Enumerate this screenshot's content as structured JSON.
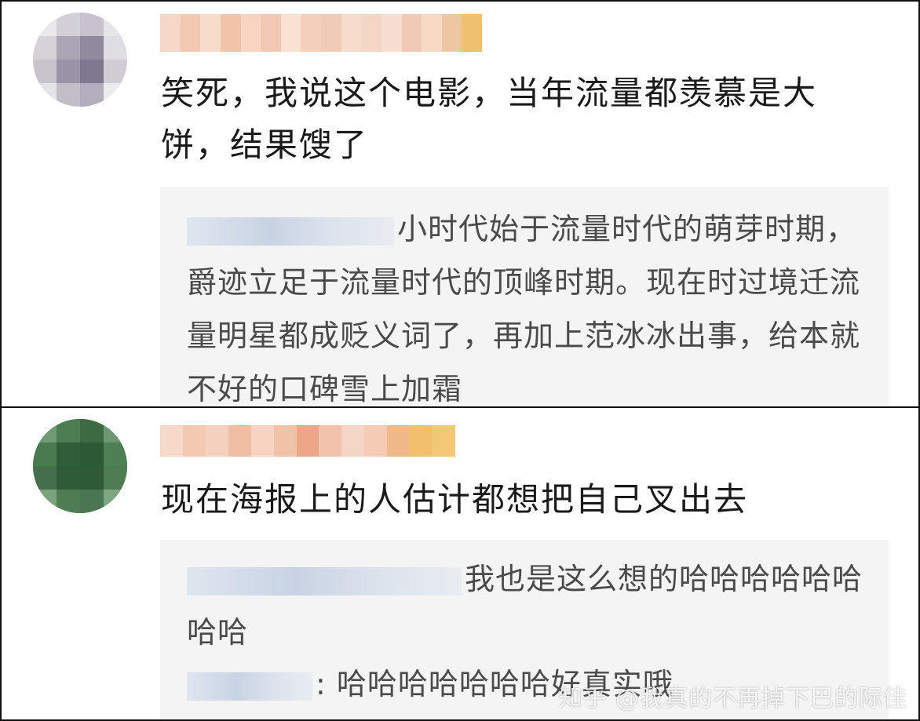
{
  "comments": [
    {
      "text": "笑死，我说这个电影，当年流量都羡慕是大饼，结果馊了",
      "replies": [
        {
          "text": "小时代始于流量时代的萌芽时期，爵迹立足于流量时代的顶峰时期。现在时过境迁流量明星都成贬义词了，再加上范冰冰出事，给本就不好的口碑雪上加霜"
        }
      ]
    },
    {
      "text": "现在海报上的人估计都想把自己叉出去",
      "replies": [
        {
          "text": "我也是这么想的哈哈哈哈哈哈哈哈"
        },
        {
          "text": ": 哈哈哈哈哈哈哈好真实哦"
        }
      ]
    }
  ],
  "watermark": "知乎 @我真的不再掉下巴的际佳"
}
